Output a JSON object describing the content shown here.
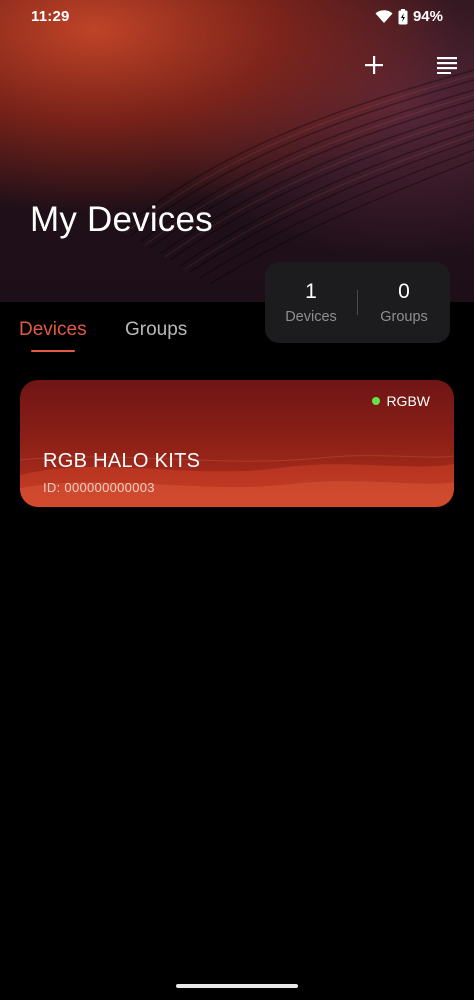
{
  "status_bar": {
    "time": "11:29",
    "battery": "94%"
  },
  "header": {
    "title": "My Devices"
  },
  "icons": {
    "add": "plus-icon",
    "menu": "list-menu-icon",
    "wifi": "wifi-icon",
    "battery": "battery-charging-icon"
  },
  "stats": {
    "devices": {
      "count": "1",
      "label": "Devices"
    },
    "groups": {
      "count": "0",
      "label": "Groups"
    }
  },
  "tabs": [
    {
      "label": "Devices",
      "active": true
    },
    {
      "label": "Groups",
      "active": false
    }
  ],
  "devices": [
    {
      "name": "RGB HALO KITS",
      "id": "ID: 000000000003",
      "type": "RGBW",
      "online": true
    }
  ],
  "colors": {
    "accent": "#e15a43",
    "status_online": "#66e34a",
    "card": "#8a1f16"
  }
}
